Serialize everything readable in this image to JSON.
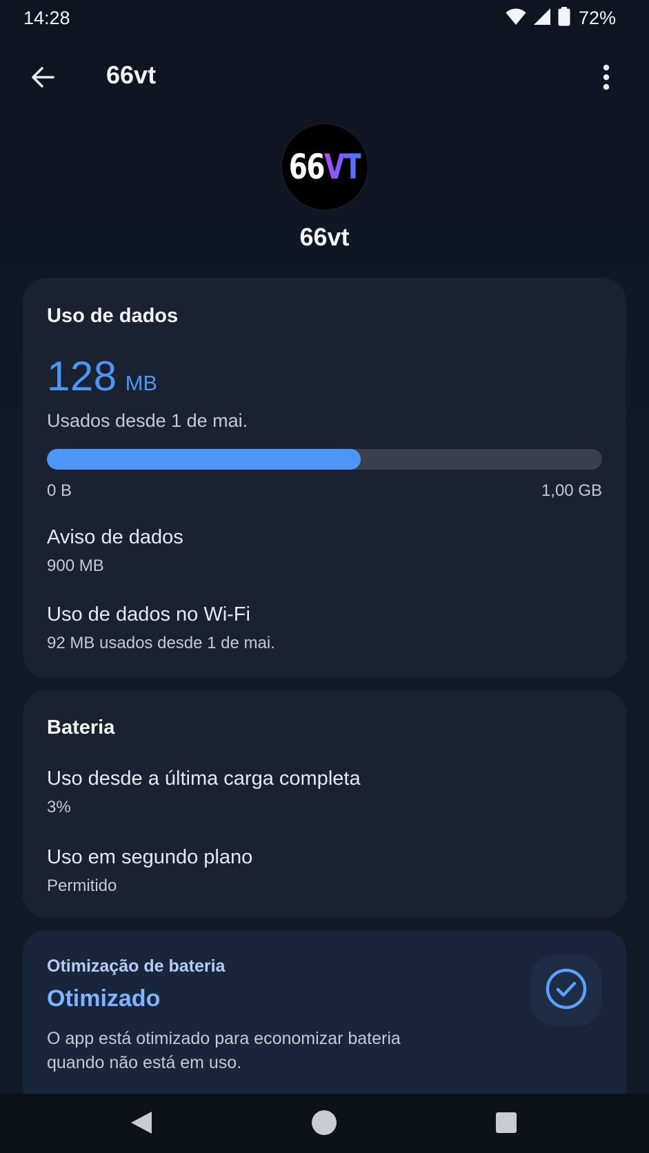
{
  "status_bar": {
    "time": "14:28",
    "battery_percent": "72%",
    "icons": [
      "wifi-icon",
      "cell-signal-icon",
      "battery-icon"
    ]
  },
  "app_bar": {
    "title": "66vt",
    "back_icon": "arrow-back-icon",
    "menu_icon": "more-vert-icon"
  },
  "app_header": {
    "icon_text_white": "66",
    "icon_text_gradient": "VT",
    "name": "66vt"
  },
  "data_usage": {
    "title": "Uso de dados",
    "amount": "128",
    "unit": "MB",
    "since": "Usados desde 1 de mai.",
    "progress_fraction": 0.565,
    "range_min": "0 B",
    "range_max": "1,00 GB",
    "warning_title": "Aviso de dados",
    "warning_value": "900 MB",
    "wifi_title": "Uso de dados no Wi-Fi",
    "wifi_value": "92 MB usados desde 1 de mai."
  },
  "battery": {
    "title": "Bateria",
    "since_full_title": "Uso desde a última carga completa",
    "since_full_value": "3%",
    "background_title": "Uso em segundo plano",
    "background_value": "Permitido"
  },
  "optimization": {
    "label": "Otimização de bateria",
    "status": "Otimizado",
    "description": "O app está otimizado para economizar bateria quando não está em uso."
  },
  "colors": {
    "accent": "#4c97f5",
    "background": "#121a27",
    "card": "#1a2130",
    "card_highlight": "#18253a"
  },
  "nav_bar": {
    "icons": [
      "nav-back-icon",
      "nav-home-icon",
      "nav-recents-icon"
    ]
  }
}
